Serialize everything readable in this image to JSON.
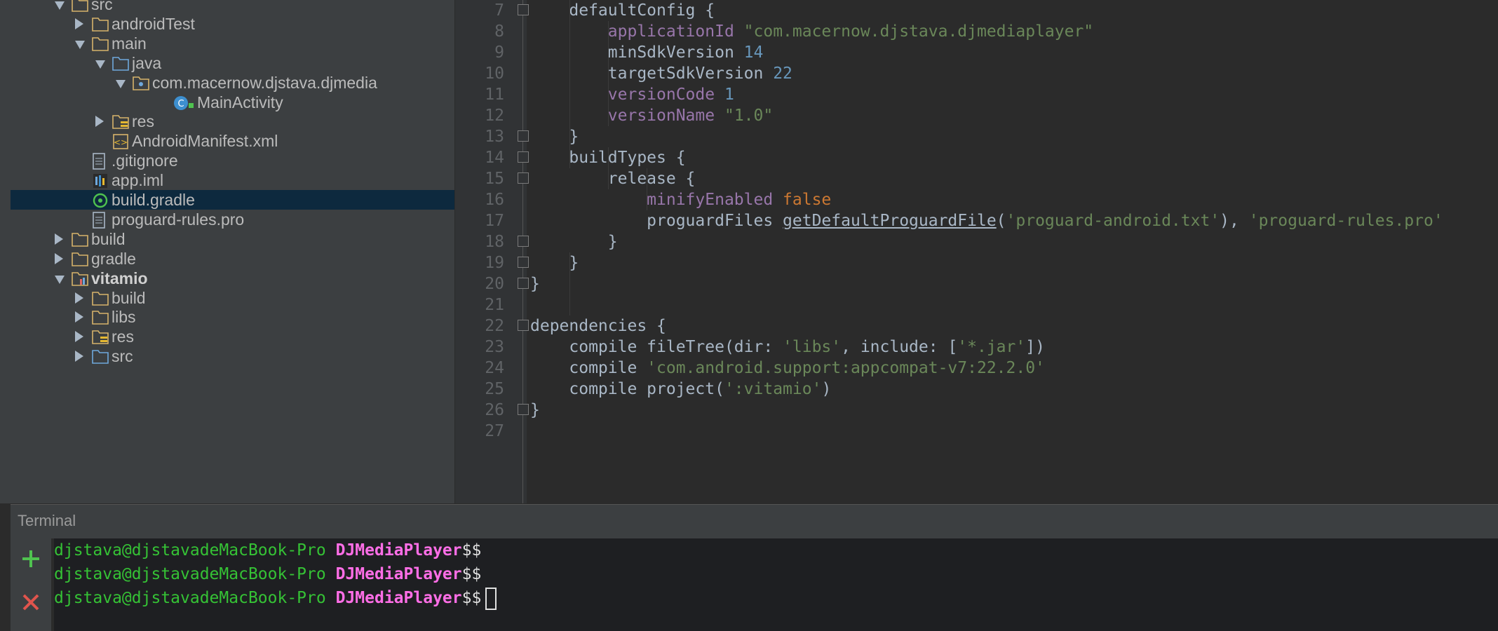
{
  "project_tree": {
    "items": [
      {
        "label": "src",
        "indent": 2,
        "arrow": "expanded",
        "icon": "folder-icon"
      },
      {
        "label": "androidTest",
        "indent": 3,
        "arrow": "collapsed",
        "icon": "folder-icon"
      },
      {
        "label": "main",
        "indent": 3,
        "arrow": "expanded",
        "icon": "folder-icon"
      },
      {
        "label": "java",
        "indent": 4,
        "arrow": "expanded",
        "icon": "source-folder-icon"
      },
      {
        "label": "com.macernow.djstava.djmedia",
        "indent": 5,
        "arrow": "expanded",
        "icon": "package-icon"
      },
      {
        "label": "MainActivity",
        "indent": 7,
        "arrow": "none",
        "icon": "class-icon"
      },
      {
        "label": "res",
        "indent": 4,
        "arrow": "collapsed",
        "icon": "resource-folder-icon"
      },
      {
        "label": "AndroidManifest.xml",
        "indent": 4,
        "arrow": "none",
        "icon": "xml-file-icon"
      },
      {
        "label": ".gitignore",
        "indent": 3,
        "arrow": "none",
        "icon": "text-file-icon"
      },
      {
        "label": "app.iml",
        "indent": 3,
        "arrow": "none",
        "icon": "iml-file-icon"
      },
      {
        "label": "build.gradle",
        "indent": 3,
        "arrow": "none",
        "icon": "gradle-file-icon",
        "selected": true
      },
      {
        "label": "proguard-rules.pro",
        "indent": 3,
        "arrow": "none",
        "icon": "text-file-icon"
      },
      {
        "label": "build",
        "indent": 2,
        "arrow": "collapsed",
        "icon": "folder-icon"
      },
      {
        "label": "gradle",
        "indent": 2,
        "arrow": "collapsed",
        "icon": "folder-icon"
      },
      {
        "label": "vitamio",
        "indent": 2,
        "arrow": "expanded",
        "icon": "module-icon",
        "bold": true
      },
      {
        "label": "build",
        "indent": 3,
        "arrow": "collapsed",
        "icon": "folder-icon"
      },
      {
        "label": "libs",
        "indent": 3,
        "arrow": "collapsed",
        "icon": "folder-icon"
      },
      {
        "label": "res",
        "indent": 3,
        "arrow": "collapsed",
        "icon": "resource-folder-icon"
      },
      {
        "label": "src",
        "indent": 3,
        "arrow": "collapsed",
        "icon": "source-folder-icon"
      }
    ]
  },
  "editor": {
    "lines": [
      {
        "n": "7",
        "parts": [
          {
            "t": "    defaultConfig {"
          }
        ]
      },
      {
        "n": "8",
        "parts": [
          {
            "t": "        "
          },
          {
            "t": "applicationId",
            "c": "prop"
          },
          {
            "t": " "
          },
          {
            "t": "\"com.macernow.djstava.djmediaplayer\"",
            "c": "str"
          }
        ]
      },
      {
        "n": "9",
        "parts": [
          {
            "t": "        minSdkVersion "
          },
          {
            "t": "14",
            "c": "num"
          }
        ]
      },
      {
        "n": "10",
        "parts": [
          {
            "t": "        targetSdkVersion "
          },
          {
            "t": "22",
            "c": "num"
          }
        ]
      },
      {
        "n": "11",
        "parts": [
          {
            "t": "        "
          },
          {
            "t": "versionCode",
            "c": "prop"
          },
          {
            "t": " "
          },
          {
            "t": "1",
            "c": "num"
          }
        ]
      },
      {
        "n": "12",
        "parts": [
          {
            "t": "        "
          },
          {
            "t": "versionName",
            "c": "prop"
          },
          {
            "t": " "
          },
          {
            "t": "\"1.0\"",
            "c": "str"
          }
        ]
      },
      {
        "n": "13",
        "parts": [
          {
            "t": "    }"
          }
        ]
      },
      {
        "n": "14",
        "parts": [
          {
            "t": "    buildTypes {"
          }
        ]
      },
      {
        "n": "15",
        "parts": [
          {
            "t": "        release {"
          }
        ]
      },
      {
        "n": "16",
        "parts": [
          {
            "t": "            "
          },
          {
            "t": "minifyEnabled",
            "c": "prop"
          },
          {
            "t": " "
          },
          {
            "t": "false",
            "c": "kw"
          }
        ]
      },
      {
        "n": "17",
        "parts": [
          {
            "t": "            proguardFiles "
          },
          {
            "t": "getDefaultProguardFile",
            "c": "fn"
          },
          {
            "t": "("
          },
          {
            "t": "'proguard-android.txt'",
            "c": "str"
          },
          {
            "t": "), "
          },
          {
            "t": "'proguard-rules.pro'",
            "c": "str"
          }
        ]
      },
      {
        "n": "18",
        "parts": [
          {
            "t": "        }"
          }
        ]
      },
      {
        "n": "19",
        "parts": [
          {
            "t": "    }"
          }
        ]
      },
      {
        "n": "20",
        "parts": [
          {
            "t": "}"
          }
        ]
      },
      {
        "n": "21",
        "parts": [
          {
            "t": ""
          }
        ]
      },
      {
        "n": "22",
        "parts": [
          {
            "t": "dependencies {"
          }
        ]
      },
      {
        "n": "23",
        "parts": [
          {
            "t": "    compile fileTree(dir: "
          },
          {
            "t": "'libs'",
            "c": "str"
          },
          {
            "t": ", include: ["
          },
          {
            "t": "'*.jar'",
            "c": "str"
          },
          {
            "t": "])"
          }
        ]
      },
      {
        "n": "24",
        "parts": [
          {
            "t": "    compile "
          },
          {
            "t": "'com.android.support:appcompat-v7:22.2.0'",
            "c": "str"
          }
        ]
      },
      {
        "n": "25",
        "parts": [
          {
            "t": "    compile project("
          },
          {
            "t": "':vitamio'",
            "c": "str"
          },
          {
            "t": ")"
          }
        ]
      },
      {
        "n": "26",
        "parts": [
          {
            "t": "}"
          }
        ]
      },
      {
        "n": "27",
        "parts": [
          {
            "t": ""
          }
        ]
      }
    ]
  },
  "terminal": {
    "title": "Terminal",
    "new_session_icon": "plus-icon",
    "close_session_icon": "close-icon",
    "prompt_user": "djstava@djstavadeMacBook-Pro",
    "prompt_dir": "DJMediaPlayer",
    "prompt_sign": "$$",
    "line_count": 3
  },
  "colors": {
    "tree_bg": "#3c3f41",
    "editor_bg": "#2b2b2b",
    "selection": "#0d293e",
    "prompt_user": "#35c235",
    "prompt_dir": "#ff6ee7"
  }
}
